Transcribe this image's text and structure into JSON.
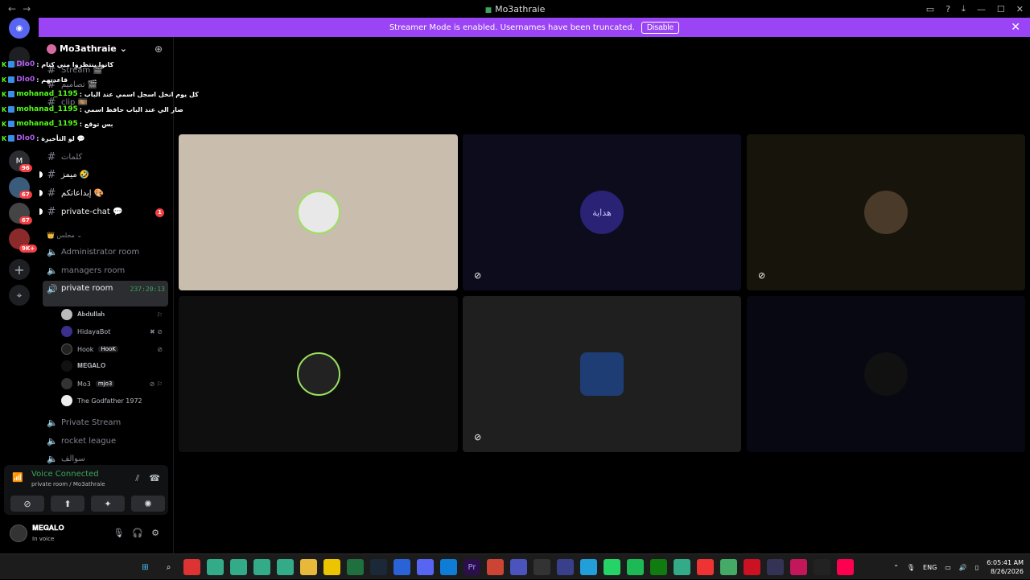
{
  "window": {
    "title": "Mo3athraie",
    "back": "←",
    "forward": "→",
    "controls": [
      "▭",
      "?",
      "⤓",
      "—",
      "☐",
      "✕"
    ]
  },
  "banner": {
    "message": "Streamer Mode is enabled. Usernames have been truncated.",
    "disable_label": "Disable",
    "close": "✕"
  },
  "rail": {
    "badges": [
      "96",
      "67",
      "67",
      "9K+"
    ]
  },
  "server": {
    "name": "Mo3athraie",
    "chevron": "⌄",
    "invite_icon": "person-add-icon"
  },
  "channels": [
    {
      "name": "Stream 🎬",
      "bright": false
    },
    {
      "name": "تصاميم 🎬",
      "bright": false
    },
    {
      "name": "clip 🎞️",
      "bright": false
    },
    {
      "name": "",
      "bright": false
    },
    {
      "name": "",
      "bright": false
    },
    {
      "name": "كلمات",
      "bright": false
    },
    {
      "name": "ميمز 🤣",
      "bright": true
    },
    {
      "name": "إبداعاتكم 🎨",
      "bright": true
    },
    {
      "name": "private-chat 💬",
      "bright": true,
      "badge": "1"
    }
  ],
  "category": "👑 مجلس ⌄",
  "voice_channels": [
    {
      "name": "Administrator room"
    },
    {
      "name": "managers room"
    }
  ],
  "active_voice": {
    "name": "private room",
    "timer": "237:20:13"
  },
  "voice_members": [
    {
      "name": "𝐀𝐛𝐝𝐮𝐥𝐥𝐚𝐡",
      "tag": "",
      "status": "⚐"
    },
    {
      "name": "HidayaBot",
      "tag": "",
      "status": "✖ ⊘"
    },
    {
      "name": "Hook",
      "tag": "HooK",
      "status": "⊘"
    },
    {
      "name": "𝐌𝐄𝐆𝐀𝐋𝐎",
      "tag": "",
      "status": ""
    },
    {
      "name": "Mo3",
      "tag": "mjo3",
      "status": "⊘ ⚐"
    },
    {
      "name": "The Godfather 1972",
      "tag": "",
      "status": ""
    }
  ],
  "more_voice_channels": [
    {
      "name": "Private Stream"
    },
    {
      "name": "rocket league"
    },
    {
      "name": "سوالف"
    }
  ],
  "voice_panel": {
    "title": "Voice Connected",
    "subtitle": "private room / Mo3athraie",
    "buttons": [
      "⊘",
      "⬆",
      "✦",
      "✺"
    ]
  },
  "user": {
    "name": "𝐌𝐄𝐆𝐀𝐋𝐎",
    "status": "In voice"
  },
  "chat_overlay": [
    {
      "user": "Dlo0",
      "color": "#b05cf0",
      "msg": ": كانوا ينتظروا مني كتام"
    },
    {
      "user": "Dlo0",
      "color": "#b05cf0",
      "msg": ": قاعدتهم"
    },
    {
      "user": "mohanad_1195",
      "color": "#53fc18",
      "msg": ": كل يوم انخل اسجل اسمي عند الباب"
    },
    {
      "user": "mohanad_1195",
      "color": "#53fc18",
      "msg": ": صار الي عند الباب حافظ اسمي"
    },
    {
      "user": "mohanad_1195",
      "color": "#53fc18",
      "msg": ": بس توقع"
    },
    {
      "user": "Dlo0",
      "color": "#b05cf0",
      "msg": ": لو التأخيرة 💬"
    }
  ],
  "tiles": [
    {
      "bg": "#c9bdad",
      "avatar_bg": "#e8e8e8",
      "ring": "#9be15d",
      "muted": false
    },
    {
      "bg": "#0d0c1c",
      "avatar_bg": "#2a2275",
      "ring": "",
      "muted": true,
      "glyph": "هداية"
    },
    {
      "bg": "#17140b",
      "avatar_bg": "#4a3a2a",
      "ring": "",
      "muted": true
    },
    {
      "bg": "#0f0f0f",
      "avatar_bg": "#222",
      "ring": "#9be15d",
      "muted": false
    },
    {
      "bg": "#1f1f1f",
      "avatar_bg": "#1d3d74",
      "ring": "",
      "muted": true
    },
    {
      "bg": "#070812",
      "avatar_bg": "#111",
      "ring": "",
      "muted": false
    }
  ],
  "tray": {
    "lang": "ENG",
    "time": "6:05:41 AM",
    "date": "8/26/2026"
  },
  "colors": {
    "banner": "#9b44f5",
    "green": "#3ba55c",
    "red": "#f23f43"
  }
}
